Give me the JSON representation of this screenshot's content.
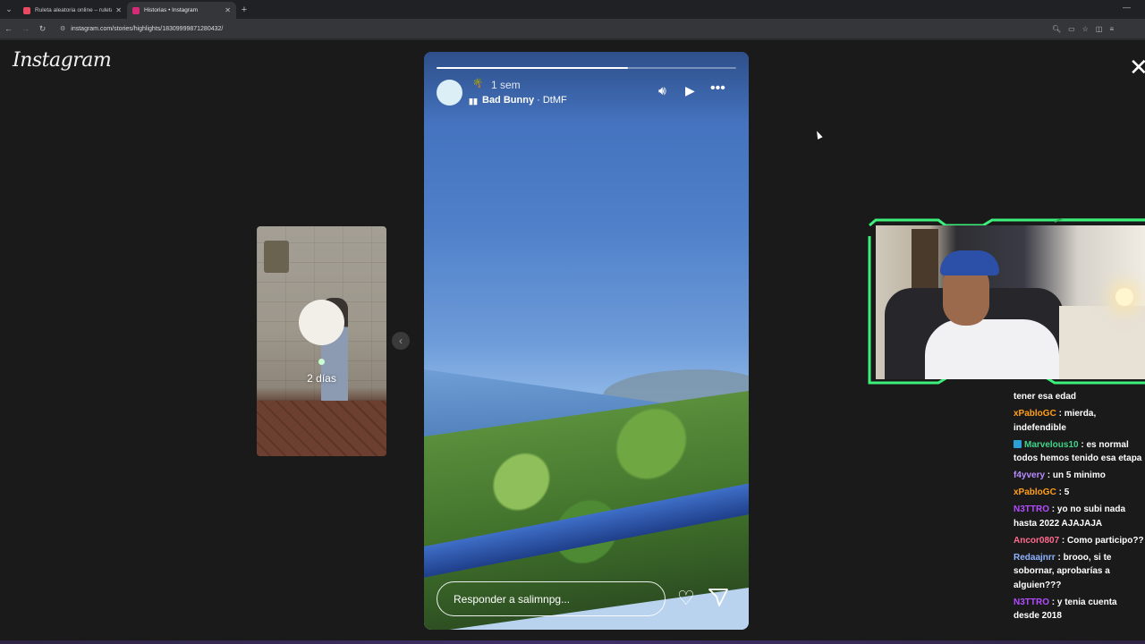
{
  "browser": {
    "tabs": [
      {
        "title": "Ruleta aleatoria online – ruleta",
        "favicon_color": "#e84a5f",
        "active": false
      },
      {
        "title": "Historias • Instagram",
        "favicon_color": "#d62976",
        "active": true
      }
    ],
    "url": "instagram.com/stories/highlights/18309999871280432/"
  },
  "instagram": {
    "logo": "Instagram",
    "previous_story": {
      "age": "2 días"
    },
    "story": {
      "progress": 0.64,
      "emoji": "🌴",
      "time": "1 sem",
      "song_artist": "Bad Bunny",
      "song_separator": " · ",
      "song_title": "DtMF",
      "reply_placeholder": "Responder a salimnpg..."
    }
  },
  "chat": {
    "messages": [
      {
        "user": "",
        "text": "tener esa edad",
        "color": "#ffffff",
        "badge": false
      },
      {
        "user": "xPabloGC",
        "text": "mierda, indefendible",
        "color": "#ff9f1a",
        "badge": false
      },
      {
        "user": "Marvelous10",
        "text": "es normal todos hemos tenido esa etapa",
        "color": "#3fd48a",
        "badge": true
      },
      {
        "user": "f4yvery",
        "text": "un 5 minimo",
        "color": "#b98cff",
        "badge": false
      },
      {
        "user": "xPabloGC",
        "text": "5",
        "color": "#ff9f1a",
        "badge": false
      },
      {
        "user": "N3TTRO",
        "text": "yo no subi nada hasta 2022 AJAJAJA",
        "color": "#b34dff",
        "badge": false
      },
      {
        "user": "Ancor0807",
        "text": "Como participo??",
        "color": "#ff6a8f",
        "badge": false
      },
      {
        "user": "Redaajnrr",
        "text": "brooo, si te sobornar, aprobarías a alguien???",
        "color": "#8fb3ff",
        "badge": false
      },
      {
        "user": "N3TTRO",
        "text": "y tenia cuenta desde 2018",
        "color": "#b34dff",
        "badge": false
      }
    ]
  }
}
